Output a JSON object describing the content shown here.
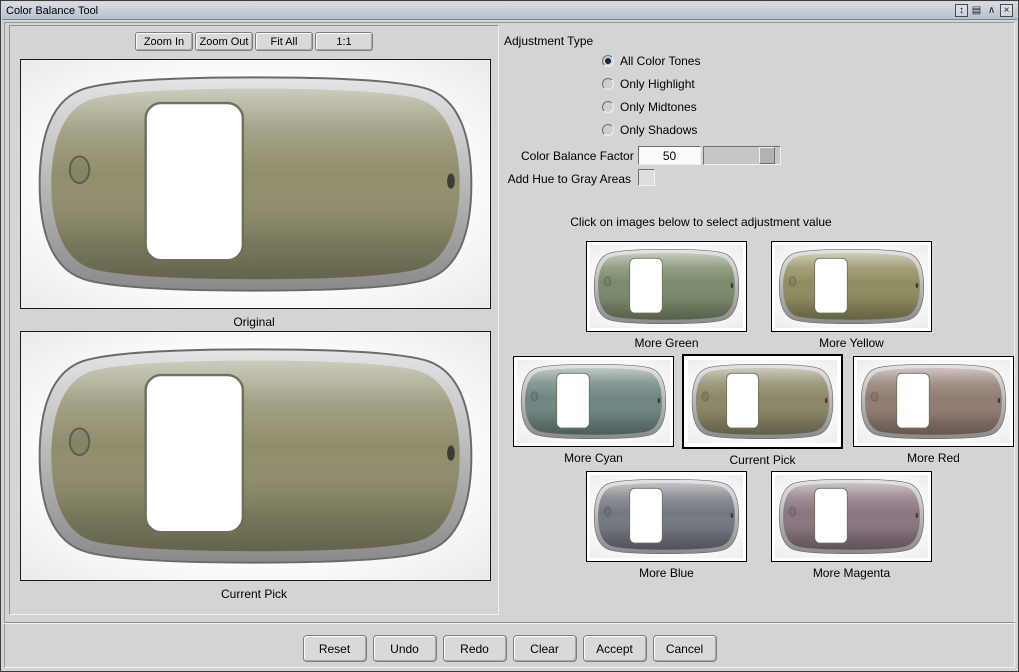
{
  "window": {
    "title": "Color Balance Tool",
    "icons": {
      "resize": "↕",
      "menu": "▤",
      "shade": "∧",
      "close": "×"
    }
  },
  "toolbar": {
    "zoom_in": "Zoom In",
    "zoom_out": "Zoom Out",
    "fit_all": "Fit All",
    "one_to_one": "1:1"
  },
  "previews": {
    "original_label": "Original",
    "current_pick_label": "Current Pick",
    "original_color": "#908e6c",
    "current_pick_color": "#8f8d6b"
  },
  "adjustment": {
    "section_label": "Adjustment Type",
    "options": [
      {
        "label": "All Color Tones",
        "selected": true
      },
      {
        "label": "Only Highlight",
        "selected": false
      },
      {
        "label": "Only Midtones",
        "selected": false
      },
      {
        "label": "Only Shadows",
        "selected": false
      }
    ],
    "factor_label": "Color Balance Factor",
    "factor_value": "50",
    "hue_gray_label": "Add Hue to Gray Areas",
    "hue_gray_checked": false
  },
  "picker": {
    "instruction": "Click on images below to select adjustment value",
    "thumbnails": [
      {
        "label": "More Green",
        "color": "#7a8a6b",
        "selected": false
      },
      {
        "label": "More Yellow",
        "color": "#8f8d5e",
        "selected": false
      },
      {
        "label": "More Cyan",
        "color": "#6e8581",
        "selected": false
      },
      {
        "label": "Current Pick",
        "color": "#8a8766",
        "selected": true
      },
      {
        "label": "More Red",
        "color": "#907b71",
        "selected": false
      },
      {
        "label": "More Blue",
        "color": "#73777f",
        "selected": false
      },
      {
        "label": "More Magenta",
        "color": "#8a7580",
        "selected": false
      }
    ]
  },
  "actions": [
    "Reset",
    "Undo",
    "Redo",
    "Clear",
    "Accept",
    "Cancel"
  ]
}
